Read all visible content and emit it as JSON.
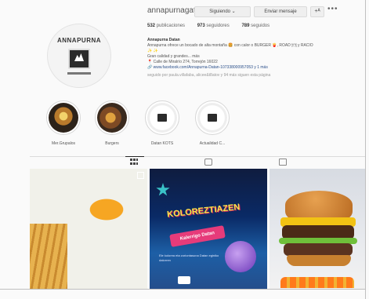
{
  "profile": {
    "username": "annapurnagatoo",
    "buttons": {
      "following": "Siguiendo ⌄",
      "message": "Enviar mensaje",
      "suggest": "+ᴬ",
      "more": "•••"
    },
    "stats": {
      "posts_count": "532",
      "posts_label": "publicaciones",
      "followers_count": "973",
      "followers_label": "seguidores",
      "following_count": "789",
      "following_label": "seguidos"
    },
    "bio": {
      "name": "Annapurna Datan",
      "line1": "Annapurna ofrece un bocado de alta montaña 🍔 con calor o BURGER 🍟, ROAD 🍽 y RACIO",
      "line2": "✨ ✨",
      "line3": "Gran calidad y grandes... más",
      "line4": "📍 Calle de Miralrío 274, Torrejón 16022",
      "link": "🔗 www.facebook.com/Annapurna-Datan-107338000957053 y 1 más",
      "followed_by": "seguido por paula.villafaba, alicee&t8atov y 94 más siguen esta página"
    },
    "avatar": {
      "brand": "ANNAPURNA"
    }
  },
  "highlights": [
    {
      "label": "Mer.Grupalos",
      "icon": "food-highlight-icon"
    },
    {
      "label": "Burgers",
      "icon": "food-highlight-icon"
    },
    {
      "label": "Datan KOTS",
      "icon": "logo-highlight-icon"
    },
    {
      "label": "Actualidad C...",
      "icon": "logo-highlight-icon"
    }
  ],
  "tabs": [
    {
      "name": "posts",
      "icon": "grid-icon",
      "active": true
    },
    {
      "name": "reels",
      "icon": "reels-icon",
      "active": false
    },
    {
      "name": "tagged",
      "icon": "tagged-icon",
      "active": false
    }
  ],
  "posts": [
    {
      "kind": "photo",
      "subject": "egg-burger"
    },
    {
      "kind": "poster",
      "title": "KOLOREZTIAZEN",
      "ribbon": "Kalerrigo Datan",
      "caption": "Ele kolorea eta zoriontasuna Datan eginiko datorren"
    },
    {
      "kind": "photo",
      "subject": "loaded-burger"
    }
  ],
  "colors": {
    "accent": "#262626",
    "link": "#2a4f8a",
    "muted": "#999999"
  }
}
